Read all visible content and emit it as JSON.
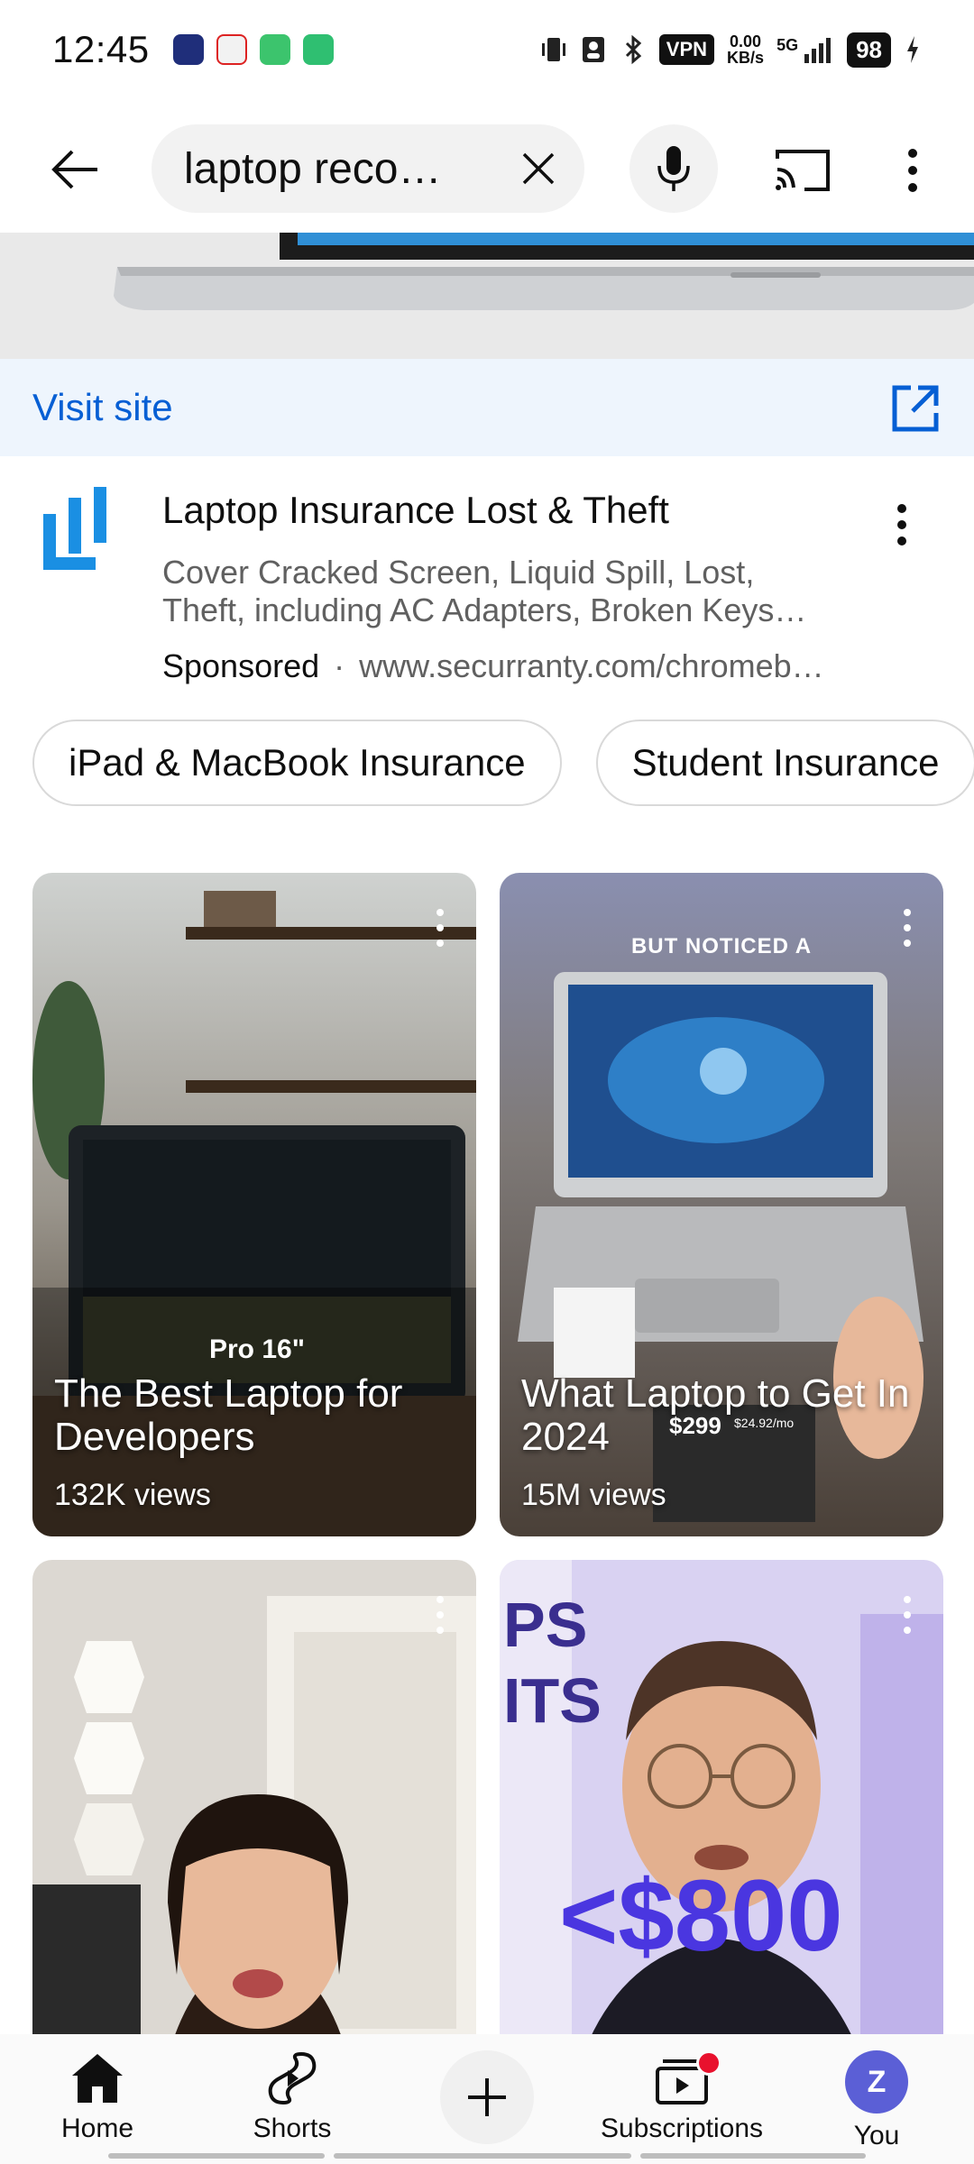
{
  "status_bar": {
    "time": "12:45",
    "vpn": "VPN",
    "net_speed_value": "0.00",
    "net_speed_unit": "KB/s",
    "signal": "5G",
    "battery": "98"
  },
  "search": {
    "query": "laptop reco…"
  },
  "ad": {
    "visit_label": "Visit site",
    "title": "Laptop Insurance Lost & Theft",
    "desc_line1": "Cover Cracked Screen, Liquid Spill, Lost,",
    "desc_line2": "Theft, including AC Adapters, Broken Keys…",
    "sponsored": "Sponsored",
    "dot": "·",
    "url": "www.securranty.com/chromeb…",
    "brand_color": "#1a8fe3"
  },
  "chips": [
    {
      "label": "iPad & MacBook Insurance"
    },
    {
      "label": "Student Insurance"
    }
  ],
  "shorts": [
    {
      "title": "The Best Laptop for Developers",
      "views": "132K views",
      "overlay": "Pro 16\""
    },
    {
      "title": "What Laptop to Get In 2024",
      "views": "15M views",
      "overlay": "BUT NOTICED A",
      "price1": "$299",
      "price2": "$24.92/mo"
    },
    {
      "title": "",
      "views": ""
    },
    {
      "title": "",
      "views": "",
      "overlay": "<$800",
      "side_text": "PS\nITS"
    }
  ],
  "nav": {
    "home": "Home",
    "shorts": "Shorts",
    "subscriptions": "Subscriptions",
    "you": "You",
    "avatar_letter": "Z"
  },
  "colors": {
    "link_blue": "#065fd4",
    "youtube_red": "#e8112d",
    "avatar_purple": "#5b5fd6"
  }
}
